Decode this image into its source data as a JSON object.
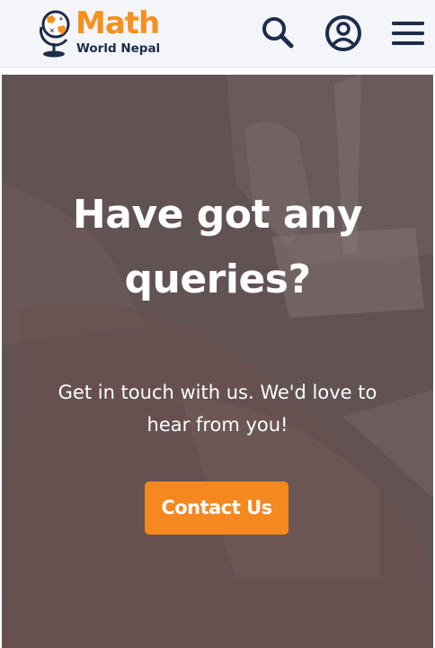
{
  "header": {
    "logo_title": "Math",
    "logo_subtitle": "World Nepal",
    "icons": {
      "search": "search-icon",
      "account": "user-circle-icon",
      "menu": "hamburger-menu-icon"
    }
  },
  "hero": {
    "heading": "Have got any queries?",
    "subtext": "Get in touch with us. We'd love to hear from you!",
    "cta_label": "Contact Us"
  },
  "colors": {
    "brand_orange": "#f6901e",
    "brand_navy": "#1d2c4c",
    "header_bg": "#f4f5f8",
    "button_bg": "#f5881f"
  }
}
